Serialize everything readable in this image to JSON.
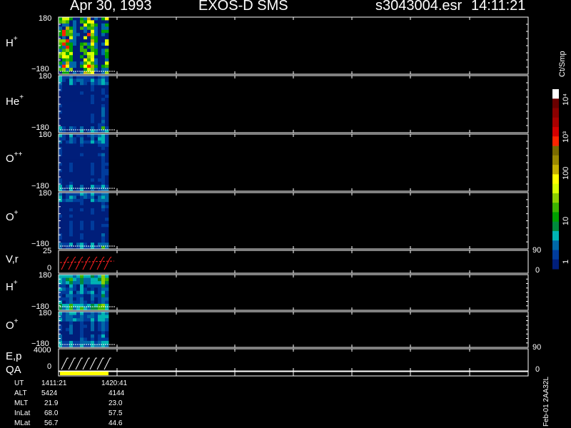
{
  "header": {
    "date": "Apr 30, 1993",
    "mission": "EXOS-D SMS",
    "file": "s3043004.esr",
    "time": "14:11:21"
  },
  "panels": [
    {
      "label_main": "H",
      "label_sup": "+",
      "ymax": "180",
      "ymin": "−180"
    },
    {
      "label_main": "He",
      "label_sup": "+",
      "ymax": "180",
      "ymin": "−180"
    },
    {
      "label_main": "O",
      "label_sup": "++",
      "ymax": "180",
      "ymin": "−180"
    },
    {
      "label_main": "O",
      "label_sup": "+",
      "ymax": "180",
      "ymin": "−180"
    },
    {
      "label_main": "V,r",
      "label_sup": "",
      "ymax": "25",
      "ymin": "0",
      "rmax": "90",
      "rmin": "0"
    },
    {
      "label_main": "H",
      "label_sup": "+",
      "ymax": "180",
      "ymin": "−180"
    },
    {
      "label_main": "O",
      "label_sup": "+",
      "ymax": "180",
      "ymin": "−180"
    },
    {
      "label_main": "E,p",
      "label_sup": "",
      "ymax": "4000",
      "ymin": "",
      "rmax": "90",
      "rmin": "0"
    },
    {
      "label_main": "QA",
      "label_sup": "",
      "ymax": "",
      "ymin": "0"
    }
  ],
  "colorbar": {
    "title": "Ct/Smp",
    "ticks": [
      "10⁴",
      "10³",
      "100",
      "10",
      "1"
    ],
    "colors": [
      "#ffffff",
      "#6a0000",
      "#8a0000",
      "#a80000",
      "#d40000",
      "#ff2400",
      "#7a6a00",
      "#9a8800",
      "#c4b000",
      "#ffff00",
      "#d8ff00",
      "#8cd000",
      "#3cb400",
      "#00a000",
      "#008a3c",
      "#00b4b4",
      "#0068a8",
      "#003c9c",
      "#001e7a"
    ]
  },
  "footer": {
    "rows": [
      {
        "name": "UT",
        "v1": "1411:21",
        "v2": "1420:41"
      },
      {
        "name": "ALT",
        "v1": "5424",
        "v2": "4144"
      },
      {
        "name": "MLT",
        "v1": "21.9",
        "v2": "23.0"
      },
      {
        "name": "InLat",
        "v1": "68.0",
        "v2": "57.5"
      },
      {
        "name": "MLat",
        "v1": "56.7",
        "v2": "44.6"
      }
    ],
    "id_text": "Feb-01 2AA32L"
  },
  "chart_data": {
    "type": "heatmap",
    "title": "Apr 30, 1993   EXOS-D SMS",
    "x_range": [
      "1411:21",
      "1420:41"
    ],
    "panels": [
      {
        "name": "H+",
        "ylim": [
          -180,
          180
        ]
      },
      {
        "name": "He+",
        "ylim": [
          -180,
          180
        ]
      },
      {
        "name": "O++",
        "ylim": [
          -180,
          180
        ]
      },
      {
        "name": "O+",
        "ylim": [
          -180,
          180
        ]
      },
      {
        "name": "V,r",
        "ylim": [
          0,
          25
        ],
        "right_ylim": [
          0,
          90
        ]
      },
      {
        "name": "H+",
        "ylim": [
          -180,
          180
        ]
      },
      {
        "name": "O+",
        "ylim": [
          -180,
          180
        ]
      },
      {
        "name": "E,p",
        "ylim": [
          0,
          4000
        ],
        "right_ylim": [
          0,
          90
        ]
      },
      {
        "name": "QA",
        "ylim": [
          0,
          0
        ]
      }
    ],
    "colorbar_scale": "log",
    "colorbar_range": [
      1,
      10000
    ]
  }
}
